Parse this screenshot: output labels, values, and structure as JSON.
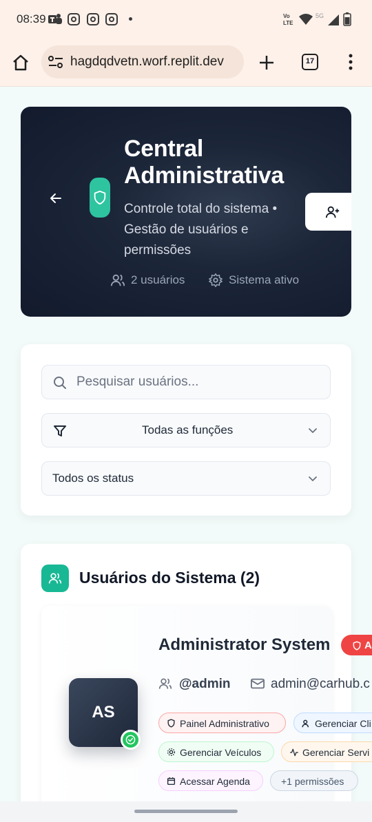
{
  "status_bar": {
    "time": "08:39"
  },
  "browser": {
    "url": "hagdqdvetn.worf.replit.dev",
    "tab_count": "17"
  },
  "hero": {
    "title": "Central Administrativa",
    "subtitle": "Controle total do sistema • Gestão de usuários e permissões",
    "users_stat": "2 usuários",
    "system_stat": "Sistema ativo"
  },
  "filters": {
    "search_placeholder": "Pesquisar usuários...",
    "role_filter": "Todas as funções",
    "status_filter": "Todos os status"
  },
  "users_section": {
    "title": "Usuários do Sistema (2)",
    "users": [
      {
        "initials": "AS",
        "name": "Administrator System",
        "role_badge": "A",
        "username": "@admin",
        "email": "admin@carhub.c",
        "permissions": [
          "Painel Administrativo",
          "Gerenciar Cli",
          "Gerenciar Veículos",
          "Gerenciar Servi",
          "Acessar Agenda",
          "+1 permissões"
        ]
      }
    ]
  },
  "colors": {
    "accent": "#18b894",
    "hero_bg": "#1c2639",
    "role_badge": "#ef4444",
    "online": "#22c55e"
  }
}
